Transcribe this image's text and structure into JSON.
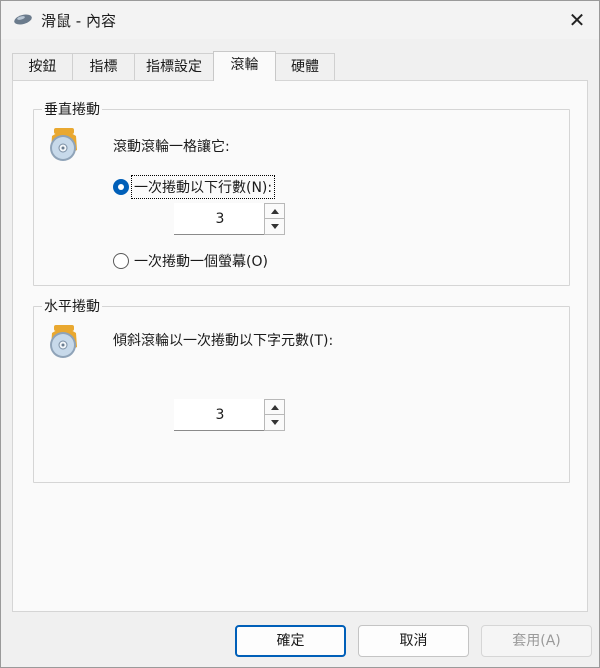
{
  "window": {
    "title": "滑鼠 - 內容",
    "close_glyph": "✕"
  },
  "tabs": [
    {
      "label": "按鈕"
    },
    {
      "label": "指標"
    },
    {
      "label": "指標設定"
    },
    {
      "label": "滾輪"
    },
    {
      "label": "硬體"
    }
  ],
  "vertical": {
    "legend": "垂直捲動",
    "prompt": "滾動滾輪一格讓它:",
    "option_lines_label": "一次捲動以下行數(N):",
    "option_lines_checked": true,
    "lines_value": "3",
    "option_screen_label": "一次捲動一個螢幕(O)",
    "option_screen_checked": false
  },
  "horizontal": {
    "legend": "水平捲動",
    "prompt": "傾斜滾輪以一次捲動以下字元數(T):",
    "chars_value": "3"
  },
  "footer": {
    "ok_label": "確定",
    "cancel_label": "取消",
    "apply_label": "套用(A)"
  },
  "colors": {
    "accent": "#005fb8",
    "wheel_body": "#e9a830",
    "wheel_disc": "#c7d9ea"
  }
}
